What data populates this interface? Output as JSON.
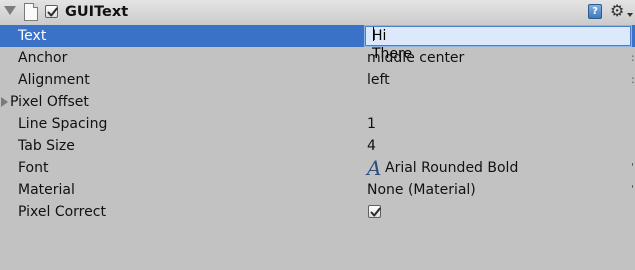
{
  "component": {
    "title": "GUIText",
    "enabled": true,
    "help_icon": "help-icon",
    "settings_icon": "gear-icon"
  },
  "properties": [
    {
      "label": "Text",
      "value": "Hi There",
      "kind": "text-input",
      "selected": true
    },
    {
      "label": "Anchor",
      "value": "middle center",
      "kind": "popup"
    },
    {
      "label": "Alignment",
      "value": "left",
      "kind": "popup"
    },
    {
      "label": "Pixel Offset",
      "value": "",
      "kind": "foldout",
      "expanded": false
    },
    {
      "label": "Line Spacing",
      "value": "1",
      "kind": "number"
    },
    {
      "label": "Tab Size",
      "value": "4",
      "kind": "number"
    },
    {
      "label": "Font",
      "value": "Arial Rounded Bold",
      "kind": "object",
      "icon": "font-icon",
      "icon_glyph": "A"
    },
    {
      "label": "Material",
      "value": "None (Material)",
      "kind": "object"
    },
    {
      "label": "Pixel Correct",
      "value": true,
      "kind": "checkbox"
    }
  ],
  "colors": {
    "background": "#c2c2c2",
    "selection": "#3a72c8",
    "field_focus": "#dce9fb"
  }
}
